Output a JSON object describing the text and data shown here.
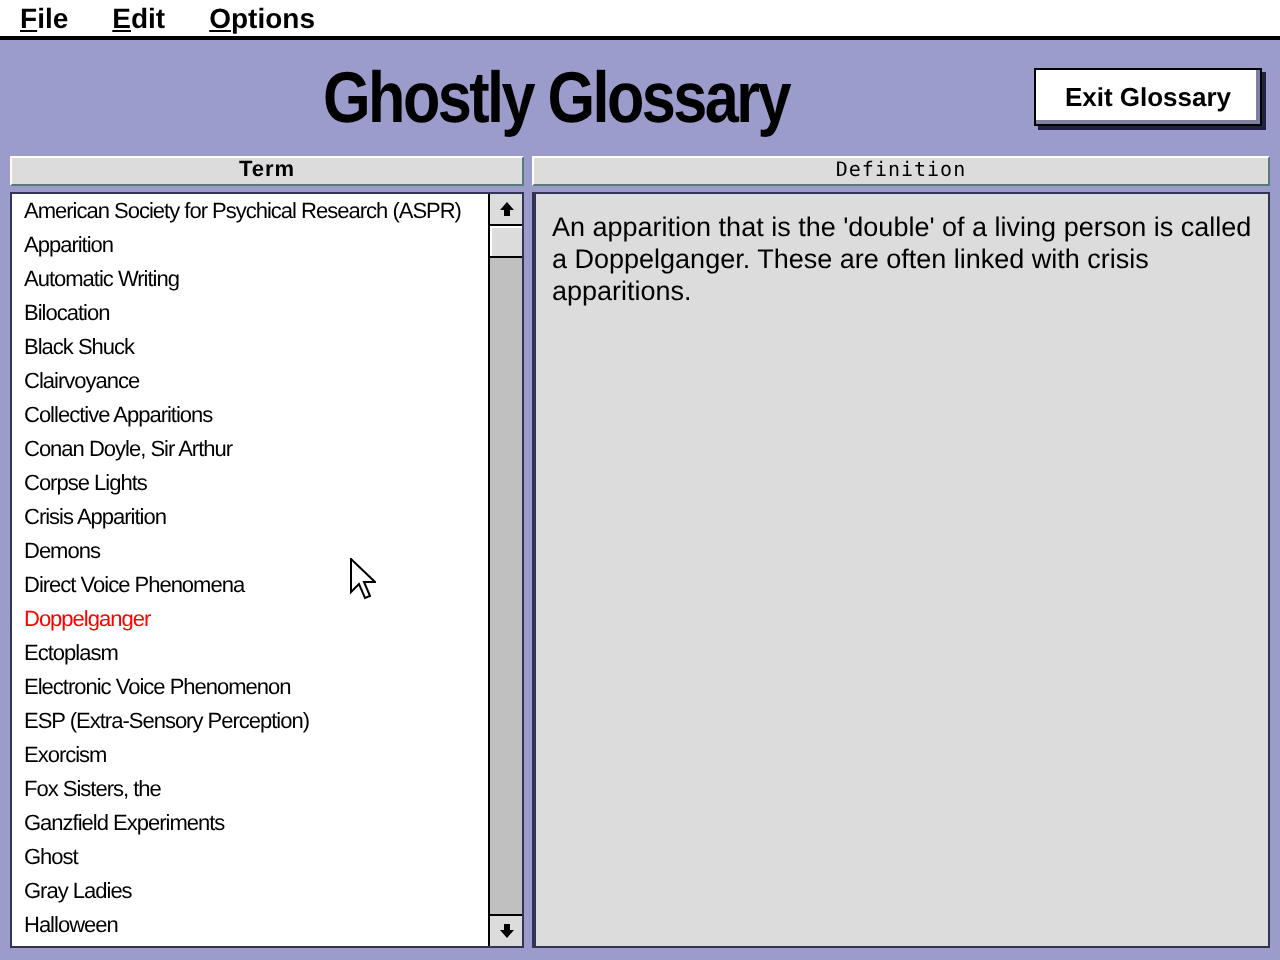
{
  "menu": [
    {
      "label": "File"
    },
    {
      "label": "Edit"
    },
    {
      "label": "Options"
    }
  ],
  "title": "Ghostly Glossary",
  "exit_button": "Exit Glossary",
  "terms": {
    "header": "Term",
    "items": [
      {
        "label": "American Society for Psychical Research (ASPR)",
        "selected": false
      },
      {
        "label": "Apparition",
        "selected": false
      },
      {
        "label": "Automatic Writing",
        "selected": false
      },
      {
        "label": "Bilocation",
        "selected": false
      },
      {
        "label": "Black Shuck",
        "selected": false
      },
      {
        "label": "Clairvoyance",
        "selected": false
      },
      {
        "label": "Collective Apparitions",
        "selected": false
      },
      {
        "label": "Conan Doyle, Sir Arthur",
        "selected": false
      },
      {
        "label": "Corpse Lights",
        "selected": false
      },
      {
        "label": "Crisis Apparition",
        "selected": false
      },
      {
        "label": "Demons",
        "selected": false
      },
      {
        "label": "Direct Voice Phenomena",
        "selected": false
      },
      {
        "label": "Doppelganger",
        "selected": true
      },
      {
        "label": "Ectoplasm",
        "selected": false
      },
      {
        "label": "Electronic Voice Phenomenon",
        "selected": false
      },
      {
        "label": "ESP (Extra-Sensory Perception)",
        "selected": false
      },
      {
        "label": "Exorcism",
        "selected": false
      },
      {
        "label": "Fox Sisters, the",
        "selected": false
      },
      {
        "label": "Ganzfield Experiments",
        "selected": false
      },
      {
        "label": "Ghost",
        "selected": false
      },
      {
        "label": "Gray Ladies",
        "selected": false
      },
      {
        "label": "Halloween",
        "selected": false
      }
    ]
  },
  "definition": {
    "header": "Definition",
    "text": "An apparition that is the 'double' of a living person is called a Doppelganger. These are often linked with crisis apparitions."
  }
}
